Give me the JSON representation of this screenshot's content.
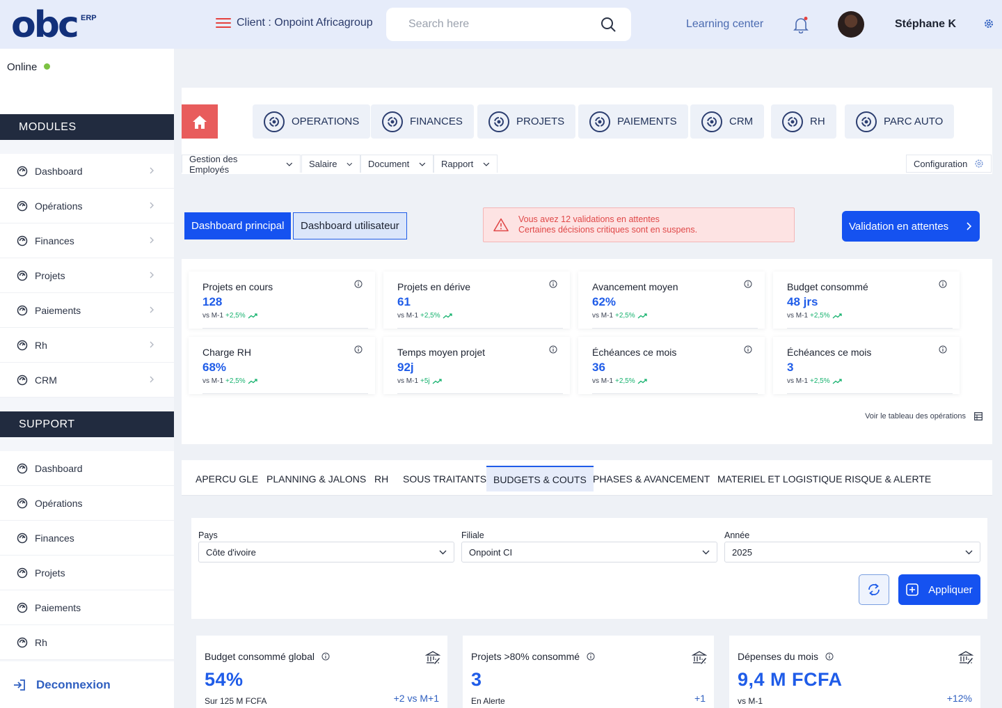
{
  "header": {
    "logo_text": "obc",
    "logo_sup": "ERP",
    "client_label": "Client : Onpoint Africagroup",
    "search_placeholder": "Search here",
    "learning_center": "Learning center",
    "user_name": "Stéphane K",
    "brand_red": "#e5413e",
    "accent_blue": "#1552f0"
  },
  "sidebar": {
    "status": "Online",
    "modules_title": "MODULES",
    "modules": [
      "Dashboard",
      "Opérations",
      "Finances",
      "Projets",
      "Paiements",
      "Rh",
      "CRM"
    ],
    "support_title": "SUPPORT",
    "support": [
      "Dashboard",
      "Opérations",
      "Finances",
      "Projets",
      "Paiements",
      "Rh"
    ],
    "logout": "Deconnexion"
  },
  "modules_bar": {
    "items": [
      "OPERATIONS",
      "FINANCES",
      "PROJETS",
      "PAIEMENTS",
      "CRM",
      "RH",
      "PARC AUTO"
    ],
    "submenu": [
      "Gestion des Employés",
      "Salaire",
      "Document",
      "Rapport"
    ],
    "config": "Configuration"
  },
  "dashboard": {
    "principal": "Dashboard principal",
    "utilisateur": "Dashboard utilisateur",
    "alert_line1": "Vous avez 12 validations en attentes",
    "alert_line2": "Certaines décisions critiques sont en suspens.",
    "validation_btn": "Validation  en attentes"
  },
  "stats": [
    {
      "title": "Projets en cours",
      "value": "128",
      "cmp": "vs M-1",
      "delta": "+2,5%"
    },
    {
      "title": "Projets en dérive",
      "value": "61",
      "cmp": "vs M-1",
      "delta": "+2,5%"
    },
    {
      "title": "Avancement moyen",
      "value": "62%",
      "cmp": "vs M-1",
      "delta": "+2,5%"
    },
    {
      "title": "Budget consommé",
      "value": "48 jrs",
      "cmp": "vs M-1",
      "delta": "+2,5%"
    },
    {
      "title": "Charge RH",
      "value": "68%",
      "cmp": "vs M-1",
      "delta": "+2,5%"
    },
    {
      "title": "Temps moyen projet",
      "value": "92j",
      "cmp": "vs M-1",
      "delta": "+5j"
    },
    {
      "title": "Échéances ce mois",
      "value": "36",
      "cmp": "vs M-1",
      "delta": "+2,5%"
    },
    {
      "title": "Échéances ce mois",
      "value": "3",
      "cmp": "vs M-1",
      "delta": "+2,5%"
    }
  ],
  "voir_link": "Voir le tableau des opérations",
  "tabs": [
    "APERCU GLE",
    "PLANNING & JALONS",
    "RH",
    "SOUS TRAITANTS",
    "BUDGETS & COUTS",
    "PHASES & AVANCEMENT",
    "MATERIEL ET LOGISTIQUE",
    "RISQUE & ALERTE"
  ],
  "active_tab": "BUDGETS & COUTS",
  "filters": {
    "pays_label": "Pays",
    "pays_value": "Côte d'ivoire",
    "filiale_label": "Filiale",
    "filiale_value": "Onpoint CI",
    "annee_label": "Année",
    "annee_value": "2025",
    "apply": "Appliquer"
  },
  "kpis": [
    {
      "title": "Budget consommé global",
      "value": "54%",
      "sub": "Sur 125 M FCFA",
      "delta": "+2 vs M+1"
    },
    {
      "title": "Projets >80% consommé",
      "value": "3",
      "sub": "En Alerte",
      "delta": "+1"
    },
    {
      "title": "Dépenses du mois",
      "value": "9,4 M FCFA",
      "sub": "vs M-1",
      "delta": "+12%"
    }
  ]
}
